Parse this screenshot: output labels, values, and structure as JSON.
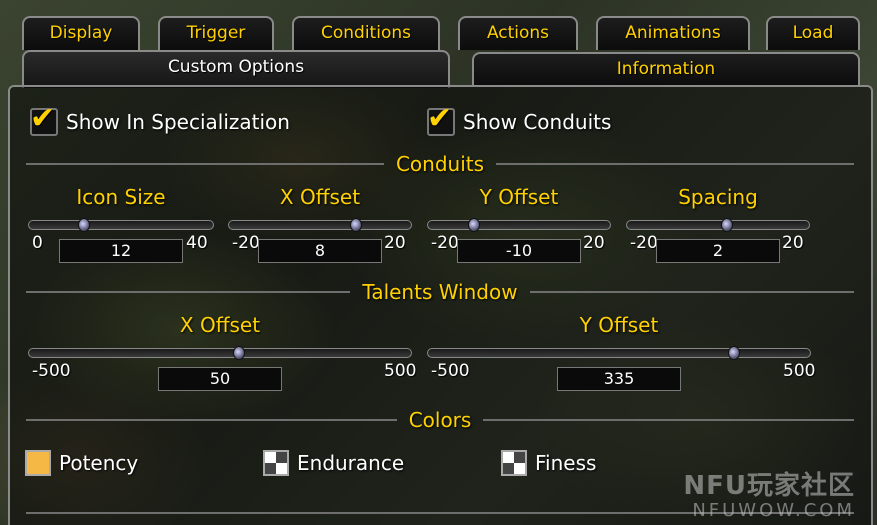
{
  "tabs_row1": [
    "Display",
    "Trigger",
    "Conditions",
    "Actions",
    "Animations",
    "Load"
  ],
  "tabs_row2": {
    "active": "Custom Options",
    "other": "Information"
  },
  "checks": {
    "spec": "Show In Specialization",
    "conduits": "Show Conduits"
  },
  "conduits": {
    "title": "Conduits",
    "sliders": [
      {
        "label": "Icon Size",
        "min": "0",
        "max": "40",
        "value": "12",
        "fraction": 0.3
      },
      {
        "label": "X Offset",
        "min": "-20",
        "max": "20",
        "value": "8",
        "fraction": 0.7
      },
      {
        "label": "Y Offset",
        "min": "-20",
        "max": "20",
        "value": "-10",
        "fraction": 0.25
      },
      {
        "label": "Spacing",
        "min": "-20",
        "max": "20",
        "value": "2",
        "fraction": 0.55
      }
    ]
  },
  "talents": {
    "title": "Talents Window",
    "sliders": [
      {
        "label": "X Offset",
        "min": "-500",
        "max": "500",
        "value": "50",
        "fraction": 0.55
      },
      {
        "label": "Y Offset",
        "min": "-500",
        "max": "500",
        "value": "335",
        "fraction": 0.8
      }
    ]
  },
  "colors": {
    "title": "Colors",
    "items": [
      {
        "label": "Potency",
        "color": "#f5b845"
      },
      {
        "label": "Endurance",
        "color": "checker"
      },
      {
        "label": "Finess",
        "color": "checker"
      }
    ]
  },
  "watermark": {
    "top": "NFU玩家社区",
    "bottom": "NFUWOW.COM"
  }
}
